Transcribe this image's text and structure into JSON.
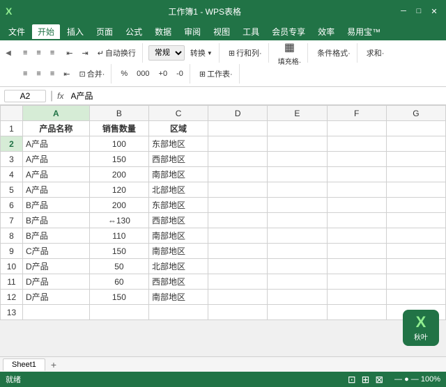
{
  "titlebar": {
    "filename": "工作簿1 - WPS表格",
    "minimize": "─",
    "maximize": "□",
    "close": "✕"
  },
  "menubar": {
    "items": [
      {
        "label": "文件",
        "active": false
      },
      {
        "label": "开始",
        "active": true
      },
      {
        "label": "插入",
        "active": false
      },
      {
        "label": "页面",
        "active": false
      },
      {
        "label": "公式",
        "active": false
      },
      {
        "label": "数据",
        "active": false
      },
      {
        "label": "审阅",
        "active": false
      },
      {
        "label": "视图",
        "active": false
      },
      {
        "label": "工具",
        "active": false
      },
      {
        "label": "会员专享",
        "active": false
      },
      {
        "label": "效率",
        "active": false
      },
      {
        "label": "易用宝",
        "active": false
      }
    ]
  },
  "ribbon": {
    "row1": {
      "group_align": {
        "btn1": "≡",
        "btn2": "≡",
        "btn3": "≡",
        "btn4": "⇥",
        "btn5": "⇥",
        "wrap_label": "自动换行"
      },
      "group_format": {
        "view_label": "常规",
        "convert_label": "转换·",
        "row_col_label": "行和列·",
        "fill_label": "填充格·"
      },
      "group_cond": {
        "cond_label": "条件格式·"
      },
      "group_sum": {
        "sum_label": "求和·"
      }
    },
    "row2": {
      "merge_label": "合并·",
      "percent_label": "%",
      "thousands_label": "000",
      "dec_inc": "+0",
      "dec_dec": "-0",
      "table_label": "工作表·"
    }
  },
  "formula_bar": {
    "cell_ref": "A2",
    "fx_label": "fx",
    "formula_value": "A产品"
  },
  "column_headers": [
    "",
    "A",
    "B",
    "C",
    "D",
    "E",
    "F",
    "G"
  ],
  "rows": [
    {
      "row_num": "",
      "cells": [
        "产品名称",
        "销售数量",
        "区域",
        "",
        "",
        "",
        ""
      ]
    },
    {
      "row_num": "1",
      "cells": [
        "",
        "",
        "",
        "",
        "",
        "",
        ""
      ]
    },
    {
      "row_num": "2",
      "cells": [
        "A产品",
        "100",
        "东部地区",
        "",
        "",
        "",
        ""
      ]
    },
    {
      "row_num": "3",
      "cells": [
        "A产品",
        "150",
        "西部地区",
        "",
        "",
        "",
        ""
      ]
    },
    {
      "row_num": "4",
      "cells": [
        "A产品",
        "200",
        "南部地区",
        "",
        "",
        "",
        ""
      ]
    },
    {
      "row_num": "5",
      "cells": [
        "A产品",
        "120",
        "北部地区",
        "",
        "",
        "",
        ""
      ]
    },
    {
      "row_num": "6",
      "cells": [
        "B产品",
        "200",
        "东部地区",
        "",
        "",
        "",
        ""
      ]
    },
    {
      "row_num": "7",
      "cells": [
        "B产品",
        "⇔130",
        "西部地区",
        "",
        "",
        "",
        ""
      ]
    },
    {
      "row_num": "8",
      "cells": [
        "B产品",
        "110",
        "南部地区",
        "",
        "",
        "",
        ""
      ]
    },
    {
      "row_num": "9",
      "cells": [
        "C产品",
        "150",
        "南部地区",
        "",
        "",
        "",
        ""
      ]
    },
    {
      "row_num": "10",
      "cells": [
        "D产品",
        "50",
        "北部地区",
        "",
        "",
        "",
        ""
      ]
    },
    {
      "row_num": "11",
      "cells": [
        "D产品",
        "60",
        "西部地区",
        "",
        "",
        "",
        ""
      ]
    },
    {
      "row_num": "12",
      "cells": [
        "D产品",
        "150",
        "南部地区",
        "",
        "",
        "",
        ""
      ]
    },
    {
      "row_num": "13",
      "cells": [
        "",
        "",
        "",
        "",
        "",
        "",
        ""
      ]
    }
  ],
  "sheet_tabs": [
    {
      "label": "Sheet1",
      "active": true
    }
  ],
  "status_bar": {
    "ready": "就绪"
  },
  "wps_logo": {
    "x": "X",
    "brand": "秋叶"
  }
}
